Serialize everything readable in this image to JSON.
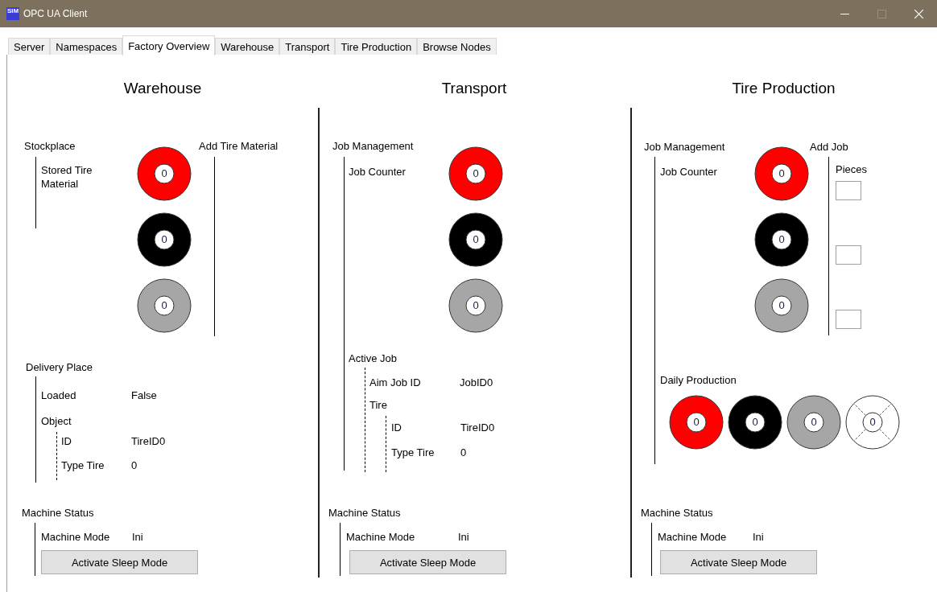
{
  "window": {
    "title": "OPC UA Client",
    "logo": "SIM",
    "controls": [
      {
        "kind": "minimize",
        "disabled": false
      },
      {
        "kind": "maximize",
        "disabled": true
      },
      {
        "kind": "close",
        "disabled": false
      }
    ]
  },
  "tabs": [
    {
      "label": "Server",
      "selected": false
    },
    {
      "label": "Namespaces",
      "selected": false
    },
    {
      "label": "Factory Overview",
      "selected": true
    },
    {
      "label": "Warehouse",
      "selected": false
    },
    {
      "label": "Transport",
      "selected": false
    },
    {
      "label": "Tire Production",
      "selected": false
    },
    {
      "label": "Browse Nodes",
      "selected": false
    }
  ],
  "warehouse": {
    "title": "Warehouse",
    "stockplace": {
      "label": "Stockplace",
      "stored_label": "Stored Tire Material",
      "add_label": "Add Tire Material",
      "tires": [
        {
          "count": "0",
          "color": "#ff0000"
        },
        {
          "count": "0",
          "color": "#000000"
        },
        {
          "count": "0",
          "color": "#a6a6a6"
        }
      ]
    },
    "delivery_place": {
      "label": "Delivery Place",
      "fields": [
        {
          "label": "Loaded",
          "value": "False"
        }
      ],
      "object": {
        "label": "Object",
        "fields": [
          {
            "label": "ID",
            "value": "TireID0"
          },
          {
            "label": "Type Tire",
            "value": "0"
          }
        ]
      }
    },
    "machine_status": {
      "label": "Machine Status",
      "mode_label": "Machine Mode",
      "mode_value": "Ini",
      "button": "Activate Sleep Mode"
    }
  },
  "transport": {
    "title": "Transport",
    "job_management": {
      "label": "Job Management",
      "counter_label": "Job Counter",
      "tires": [
        {
          "count": "0",
          "color": "#ff0000"
        },
        {
          "count": "0",
          "color": "#000000"
        },
        {
          "count": "0",
          "color": "#a6a6a6"
        }
      ]
    },
    "active_job": {
      "label": "Active Job",
      "fields": [
        {
          "label": "Aim Job ID",
          "value": "JobID0"
        }
      ],
      "tire": {
        "label": "Tire",
        "fields": [
          {
            "label": "ID",
            "value": "TireID0"
          },
          {
            "label": "Type Tire",
            "value": "0"
          }
        ]
      }
    },
    "machine_status": {
      "label": "Machine Status",
      "mode_label": "Machine Mode",
      "mode_value": "Ini",
      "button": "Activate Sleep Mode"
    }
  },
  "tire_production": {
    "title": "Tire Production",
    "job_management": {
      "label": "Job Management",
      "counter_label": "Job Counter",
      "tires": [
        {
          "count": "0",
          "color": "#ff0000",
          "pieces_field": true
        },
        {
          "count": "0",
          "color": "#000000",
          "pieces_field": true
        },
        {
          "count": "0",
          "color": "#a6a6a6",
          "pieces_field": true
        }
      ]
    },
    "add_job": {
      "label": "Add Job",
      "pieces_label": "Pieces"
    },
    "daily_production": {
      "label": "Daily Production",
      "tires": [
        {
          "count": "0",
          "color": "#ff0000",
          "kind": "solid"
        },
        {
          "count": "0",
          "color": "#000000",
          "kind": "solid"
        },
        {
          "count": "0",
          "color": "#a6a6a6",
          "kind": "solid"
        },
        {
          "count": "0",
          "color": "#ffffff",
          "kind": "blank"
        }
      ]
    },
    "machine_status": {
      "label": "Machine Status",
      "mode_label": "Machine Mode",
      "mode_value": "Ini",
      "button": "Activate Sleep Mode"
    }
  }
}
